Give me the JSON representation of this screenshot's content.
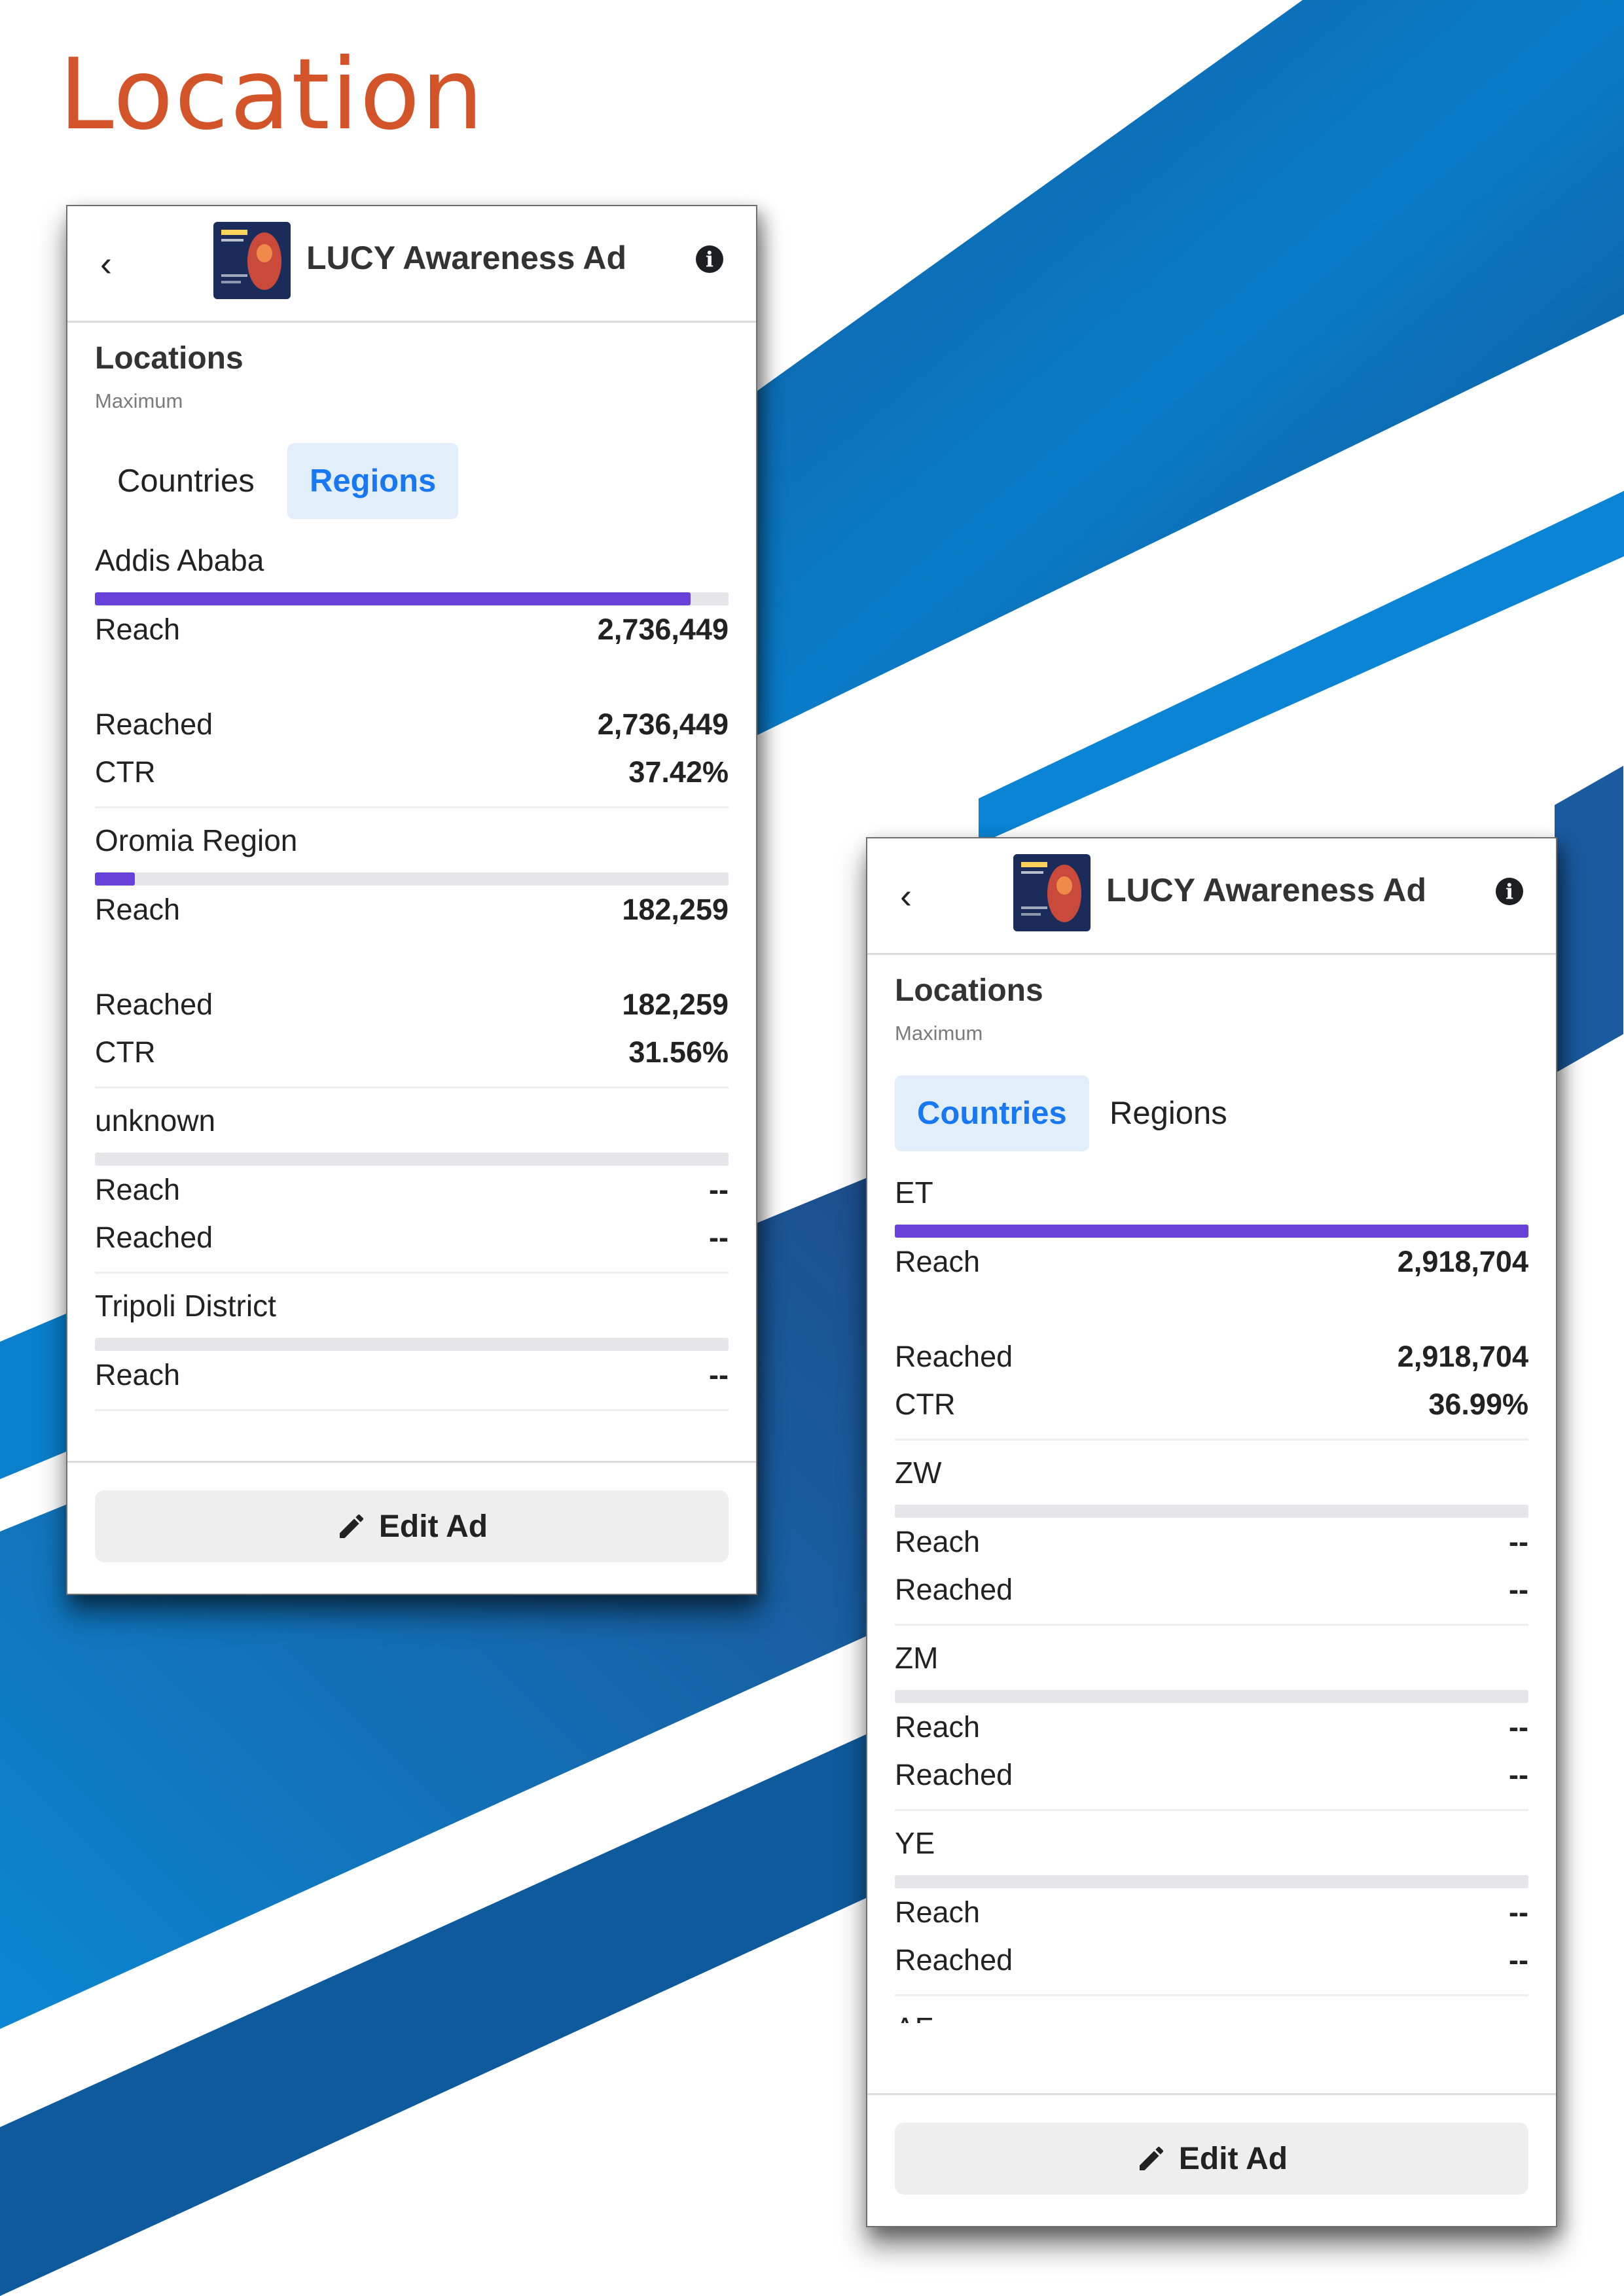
{
  "page": {
    "title": "Location"
  },
  "colors": {
    "title": "#d4542a",
    "accent_bar": "#6741d9",
    "tab_active_text": "#1877f2",
    "tab_active_bg": "#e3eefb",
    "bg_blue": "#0a78c7"
  },
  "panels": [
    {
      "header": {
        "title": "LUCY Awareness Ad"
      },
      "section": {
        "title": "Locations",
        "subtitle": "Maximum"
      },
      "tabs": [
        {
          "label": "Countries",
          "active": false
        },
        {
          "label": "Regions",
          "active": true
        }
      ],
      "items": [
        {
          "name": "Addis Ababa",
          "bar_fraction": 0.94,
          "reach_label": "Reach",
          "reach": "2,736,449",
          "reached_label": "Reached",
          "reached": "2,736,449",
          "ctr_label": "CTR",
          "ctr": "37.42%"
        },
        {
          "name": "Oromia Region",
          "bar_fraction": 0.063,
          "reach_label": "Reach",
          "reach": "182,259",
          "reached_label": "Reached",
          "reached": "182,259",
          "ctr_label": "CTR",
          "ctr": "31.56%"
        },
        {
          "name": "unknown",
          "bar_fraction": 0,
          "reach_label": "Reach",
          "reach": "--",
          "reached_label": "Reached",
          "reached": "--"
        },
        {
          "name": "Tripoli District",
          "bar_fraction": 0,
          "reach_label": "Reach",
          "reach": "--"
        }
      ],
      "footer": {
        "edit_label": "Edit Ad"
      }
    },
    {
      "header": {
        "title": "LUCY Awareness Ad"
      },
      "section": {
        "title": "Locations",
        "subtitle": "Maximum"
      },
      "tabs": [
        {
          "label": "Countries",
          "active": true
        },
        {
          "label": "Regions",
          "active": false
        }
      ],
      "items": [
        {
          "name": "ET",
          "bar_fraction": 1.0,
          "reach_label": "Reach",
          "reach": "2,918,704",
          "reached_label": "Reached",
          "reached": "2,918,704",
          "ctr_label": "CTR",
          "ctr": "36.99%"
        },
        {
          "name": "ZW",
          "bar_fraction": 0,
          "reach_label": "Reach",
          "reach": "--",
          "reached_label": "Reached",
          "reached": "--"
        },
        {
          "name": "ZM",
          "bar_fraction": 0,
          "reach_label": "Reach",
          "reach": "--",
          "reached_label": "Reached",
          "reached": "--"
        },
        {
          "name": "YE",
          "bar_fraction": 0,
          "reach_label": "Reach",
          "reach": "--",
          "reached_label": "Reached",
          "reached": "--"
        },
        {
          "name": "AF"
        }
      ],
      "footer": {
        "edit_label": "Edit Ad"
      }
    }
  ]
}
